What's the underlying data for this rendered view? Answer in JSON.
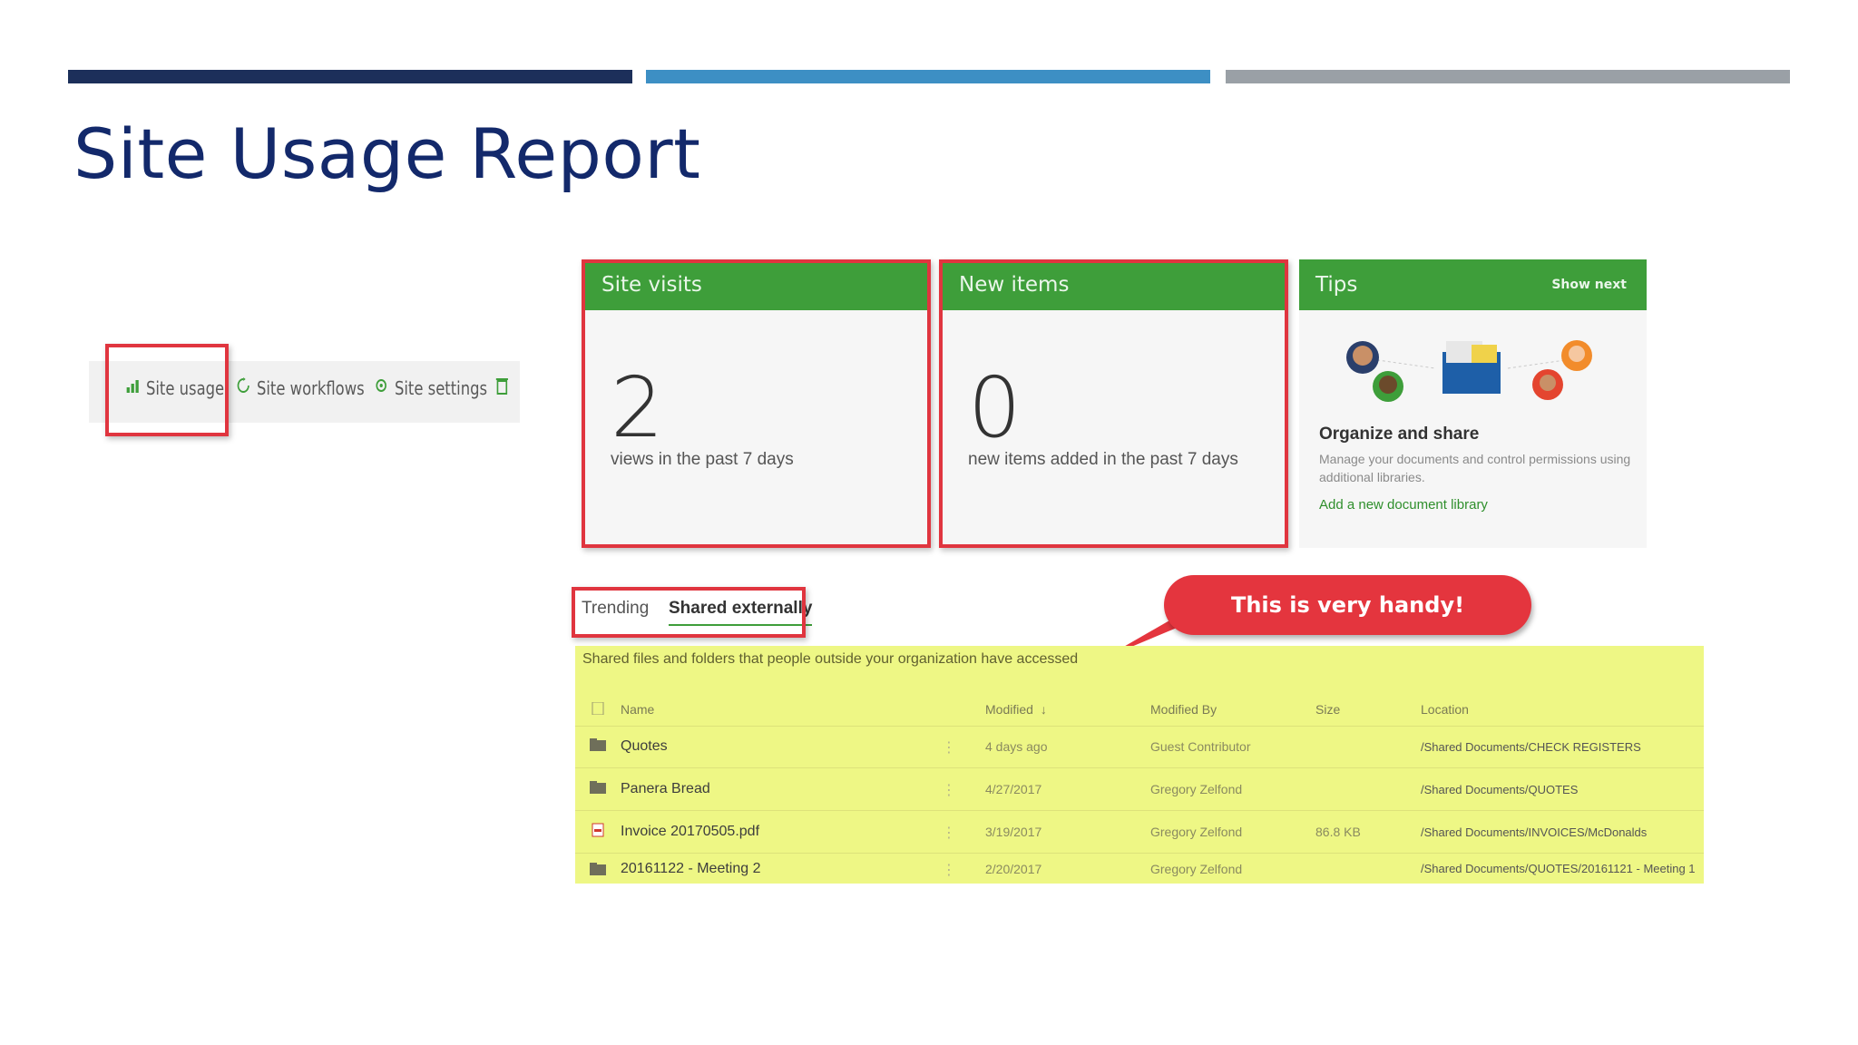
{
  "colors": {
    "bar1": "#1c2f5a",
    "bar2": "#3d8fc4",
    "bar3": "#9aa0a6",
    "accent_green": "#3e9e3a",
    "highlight_red": "#e0353f",
    "yellow": "#eef785"
  },
  "slide": {
    "title": "Site Usage Report"
  },
  "toolbar": {
    "site_usage": "Site usage",
    "site_workflows": "Site workflows",
    "site_settings": "Site settings",
    "icons": [
      "chart-icon",
      "refresh-icon",
      "gear-icon",
      "trash-icon"
    ]
  },
  "cards": {
    "site_visits": {
      "title": "Site visits",
      "value": "2",
      "caption": "views in the past 7 days"
    },
    "new_items": {
      "title": "New items",
      "value": "0",
      "caption": "new items added in the past 7 days"
    },
    "tips": {
      "title": "Tips",
      "show_next": "Show next",
      "heading": "Organize and share",
      "text": "Manage your documents and control permissions using additional libraries.",
      "link": "Add a new document library"
    }
  },
  "tabs": {
    "trending": "Trending",
    "shared_externally": "Shared externally"
  },
  "callout": "This is very handy!",
  "shared": {
    "description": "Shared files and folders that people outside your organization have accessed",
    "columns": {
      "name": "Name",
      "modified": "Modified",
      "sort_indicator": "↓",
      "modified_by": "Modified By",
      "size": "Size",
      "location": "Location"
    },
    "rows": [
      {
        "name": "Quotes",
        "modified": "4 days ago",
        "modified_by": "Guest Contributor",
        "size": "",
        "location": "/Shared Documents/CHECK REGISTERS",
        "icon": "folder-icon"
      },
      {
        "name": "Panera Bread",
        "modified": "4/27/2017",
        "modified_by": "Gregory Zelfond",
        "size": "",
        "location": "/Shared Documents/QUOTES",
        "icon": "folder-icon"
      },
      {
        "name": "Invoice 20170505.pdf",
        "modified": "3/19/2017",
        "modified_by": "Gregory Zelfond",
        "size": "86.8 KB",
        "location": "/Shared Documents/INVOICES/McDonalds",
        "icon": "pdf-icon"
      },
      {
        "name": "20161122 - Meeting 2",
        "modified": "2/20/2017",
        "modified_by": "Gregory Zelfond",
        "size": "",
        "location": "/Shared Documents/QUOTES/20161121 - Meeting 1",
        "icon": "folder-icon"
      }
    ]
  }
}
